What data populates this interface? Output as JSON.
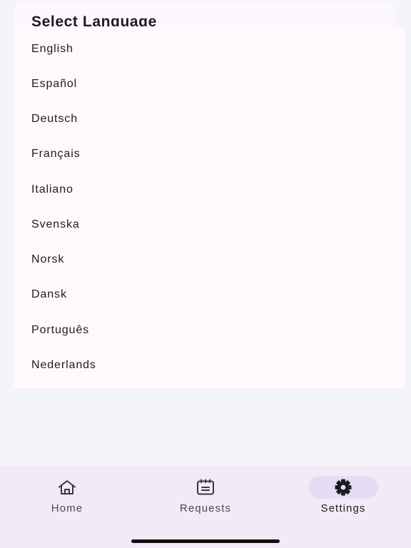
{
  "dialog": {
    "title": "Select Language"
  },
  "languages": [
    {
      "label": "English"
    },
    {
      "label": "Español"
    },
    {
      "label": "Deutsch"
    },
    {
      "label": "Français"
    },
    {
      "label": "Italiano"
    },
    {
      "label": "Svenska"
    },
    {
      "label": "Norsk"
    },
    {
      "label": "Dansk"
    },
    {
      "label": "Português"
    },
    {
      "label": "Nederlands"
    }
  ],
  "nav": {
    "items": [
      {
        "label": "Home",
        "icon": "home-icon",
        "active": false
      },
      {
        "label": "Requests",
        "icon": "calendar-list-icon",
        "active": false
      },
      {
        "label": "Settings",
        "icon": "gear-icon",
        "active": true
      }
    ]
  },
  "colors": {
    "background": "#f4f5fa",
    "menu_surface": "#fff8fc",
    "nav_surface": "#f2ebf7",
    "active_indicator": "#e6dcf6",
    "text_primary": "#1c1b1f",
    "text_secondary": "#4a4650"
  }
}
